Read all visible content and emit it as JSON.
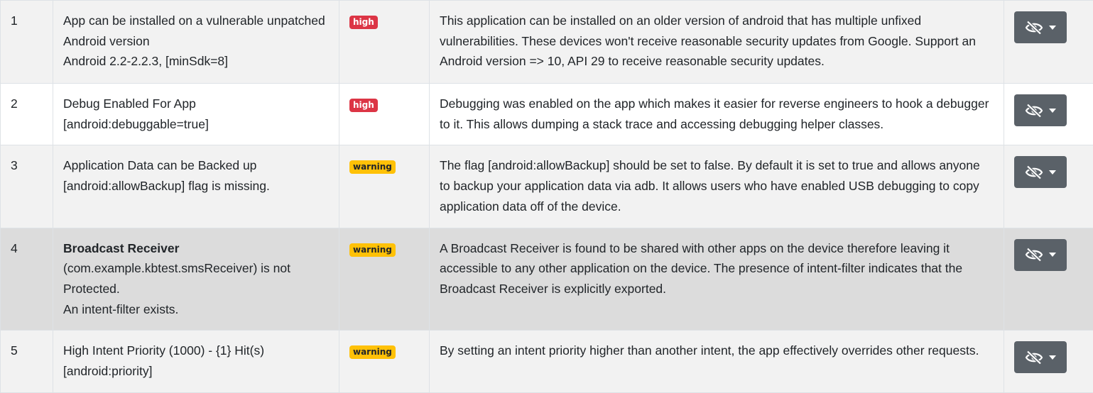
{
  "rows": [
    {
      "num": "1",
      "issue_lines": [
        "App can be installed on a vulnerable unpatched Android version",
        "Android 2.2-2.2.3, [minSdk=8]"
      ],
      "severity": "high",
      "description": "This application can be installed on an older version of android that has multiple unfixed vulnerabilities. These devices won't receive reasonable security updates from Google. Support an Android version => 10, API 29 to receive reasonable security updates.",
      "action_icon": "eye-slash-icon"
    },
    {
      "num": "2",
      "issue_lines": [
        "Debug Enabled For App",
        "[android:debuggable=true]"
      ],
      "severity": "high",
      "description": "Debugging was enabled on the app which makes it easier for reverse engineers to hook a debugger to it. This allows dumping a stack trace and accessing debugging helper classes.",
      "action_icon": "eye-slash-icon"
    },
    {
      "num": "3",
      "issue_lines": [
        "Application Data can be Backed up",
        "[android:allowBackup] flag is missing."
      ],
      "severity": "warning",
      "description": "The flag [android:allowBackup] should be set to false. By default it is set to true and allows anyone to backup your application data via adb. It allows users who have enabled USB debugging to copy application data off of the device.",
      "action_icon": "eye-slash-icon"
    },
    {
      "num": "4",
      "issue_title": "Broadcast Receiver",
      "issue_lines": [
        "(com.example.kbtest.smsReceiver) is not Protected.",
        "An intent-filter exists."
      ],
      "severity": "warning",
      "description": "A Broadcast Receiver is found to be shared with other apps on the device therefore leaving it accessible to any other application on the device. The presence of intent-filter indicates that the Broadcast Receiver is explicitly exported.",
      "action_icon": "eye-slash-icon"
    },
    {
      "num": "5",
      "issue_lines": [
        "High Intent Priority (1000) - {1} Hit(s)",
        "[android:priority]"
      ],
      "severity": "warning",
      "description": "By setting an intent priority higher than another intent, the app effectively overrides other requests.",
      "action_icon": "eye-slash-icon"
    }
  ],
  "colors": {
    "high_badge": "#dc3545",
    "warning_badge": "#ffc107",
    "action_button": "#5a6168",
    "row_stripe": "#f2f2f2",
    "row_hover": "#dcdcdc"
  }
}
